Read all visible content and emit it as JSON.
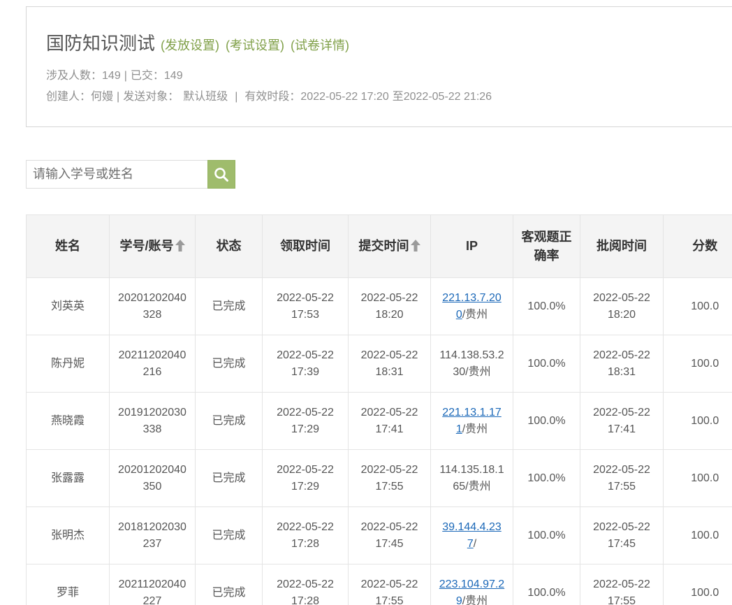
{
  "exam": {
    "title": "国防知识测试",
    "links": [
      {
        "label": "(发放设置)"
      },
      {
        "label": "(考试设置)"
      },
      {
        "label": "(试卷详情)"
      }
    ]
  },
  "info": {
    "participants_label": "涉及人数：",
    "participants": "149",
    "separator": "|",
    "submitted_label": "已交：",
    "submitted": "149",
    "creator_label": "创建人：",
    "creator": "何嫚",
    "target_label": "发送对象：",
    "target": "默认班级",
    "period_label": "有效时段：",
    "period_start": "2022-05-22 17:20",
    "period_to": "至",
    "period_end": "2022-05-22 21:26"
  },
  "search": {
    "placeholder": "请输入学号或姓名",
    "value": "",
    "button_icon": "search-icon"
  },
  "table": {
    "columns": [
      {
        "label": "姓名"
      },
      {
        "label": "学号/账号",
        "sortable": true,
        "sort_icon": "arrow-up-icon"
      },
      {
        "label": "状态"
      },
      {
        "label": "领取时间"
      },
      {
        "label": "提交时间",
        "sortable": true,
        "sort_icon": "arrow-up-icon"
      },
      {
        "label": "IP"
      },
      {
        "label": "客观题正确率"
      },
      {
        "label": "批阅时间"
      },
      {
        "label": "分数"
      }
    ],
    "rows": [
      {
        "name": "刘英英",
        "student_id": "20201202040328",
        "status": "已完成",
        "received_time": "2022-05-22 17:53",
        "submitted_time": "2022-05-22 18:20",
        "ip": "221.13.7.200",
        "ip_is_link": true,
        "location": "/贵州",
        "objective_accuracy": "100.0%",
        "reviewed_time": "2022-05-22 18:20",
        "score": "100.0"
      },
      {
        "name": "陈丹妮",
        "student_id": "20211202040216",
        "status": "已完成",
        "received_time": "2022-05-22 17:39",
        "submitted_time": "2022-05-22 18:31",
        "ip": "114.138.53.230",
        "ip_is_link": false,
        "location": "/贵州",
        "objective_accuracy": "100.0%",
        "reviewed_time": "2022-05-22 18:31",
        "score": "100.0"
      },
      {
        "name": "燕晓霞",
        "student_id": "20191202030338",
        "status": "已完成",
        "received_time": "2022-05-22 17:29",
        "submitted_time": "2022-05-22 17:41",
        "ip": "221.13.1.171",
        "ip_is_link": true,
        "location": "/贵州",
        "objective_accuracy": "100.0%",
        "reviewed_time": "2022-05-22 17:41",
        "score": "100.0"
      },
      {
        "name": "张露露",
        "student_id": "20201202040350",
        "status": "已完成",
        "received_time": "2022-05-22 17:29",
        "submitted_time": "2022-05-22 17:55",
        "ip": "114.135.18.165",
        "ip_is_link": false,
        "location": "/贵州",
        "objective_accuracy": "100.0%",
        "reviewed_time": "2022-05-22 17:55",
        "score": "100.0"
      },
      {
        "name": "张明杰",
        "student_id": "20181202030237",
        "status": "已完成",
        "received_time": "2022-05-22 17:28",
        "submitted_time": "2022-05-22 17:45",
        "ip": "39.144.4.237",
        "ip_is_link": true,
        "location": "/",
        "objective_accuracy": "100.0%",
        "reviewed_time": "2022-05-22 17:45",
        "score": "100.0"
      },
      {
        "name": "罗菲",
        "student_id": "20211202040227",
        "status": "已完成",
        "received_time": "2022-05-22 17:28",
        "submitted_time": "2022-05-22 17:55",
        "ip": "223.104.97.29",
        "ip_is_link": true,
        "location": "/贵州",
        "objective_accuracy": "100.0%",
        "reviewed_time": "2022-05-22 17:55",
        "score": "100.0"
      }
    ]
  },
  "theme": {
    "title_link_color": "#7f9f47",
    "search_button_color": "#9fbc6c",
    "ip_link_color": "#1b68b8",
    "header_background": "#f4f4f4",
    "border_color": "#e4e4e4",
    "text_color": "#555555",
    "meta_text_color": "#8f8f8f"
  }
}
